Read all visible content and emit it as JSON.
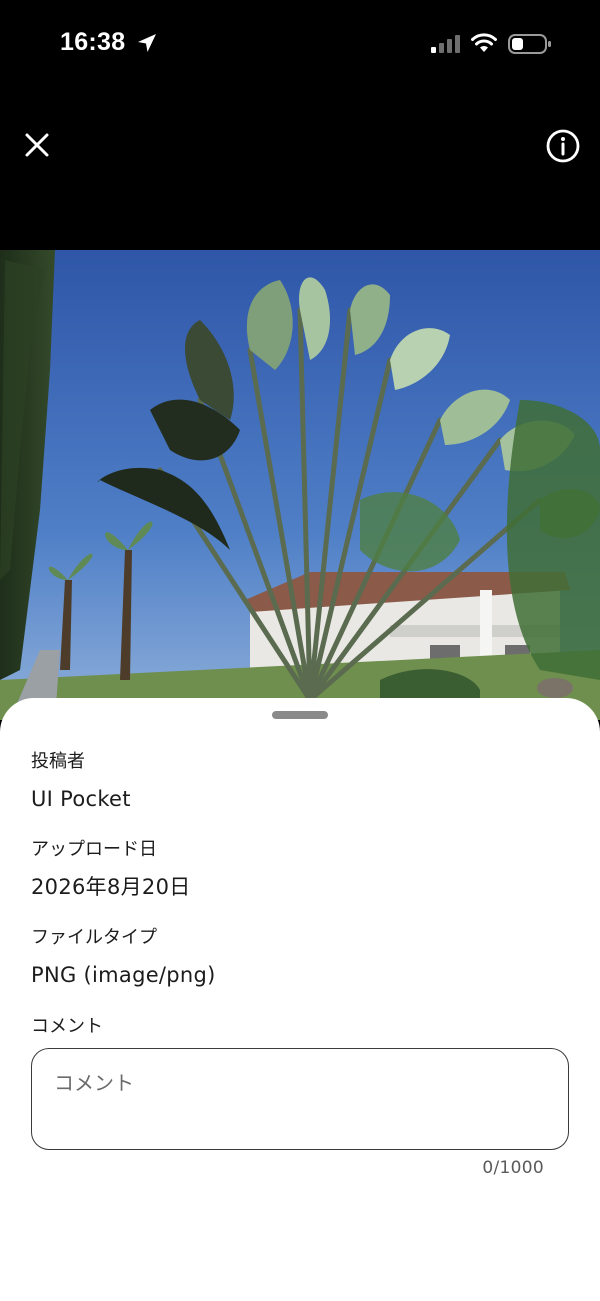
{
  "status_bar": {
    "time": "16:38",
    "icons": [
      "location-arrow-icon",
      "cellular-signal-icon",
      "wifi-icon",
      "battery-icon"
    ]
  },
  "header": {
    "close_icon": "close-icon",
    "info_icon": "info-icon"
  },
  "photo": {
    "subject": "palm-photo"
  },
  "details": {
    "poster_label": "投稿者",
    "poster_value": "UI Pocket",
    "upload_label": "アップロード日",
    "upload_value": "2026年8月20日",
    "filetype_label": "ファイルタイプ",
    "filetype_value": "PNG (image/png)"
  },
  "comment": {
    "label": "コメント",
    "placeholder": "コメント",
    "value": "",
    "counter": "0/1000"
  },
  "colors": {
    "background": "#000000",
    "sheet": "#ffffff",
    "text": "#1c1c1c",
    "sky": "#3b66b8"
  }
}
